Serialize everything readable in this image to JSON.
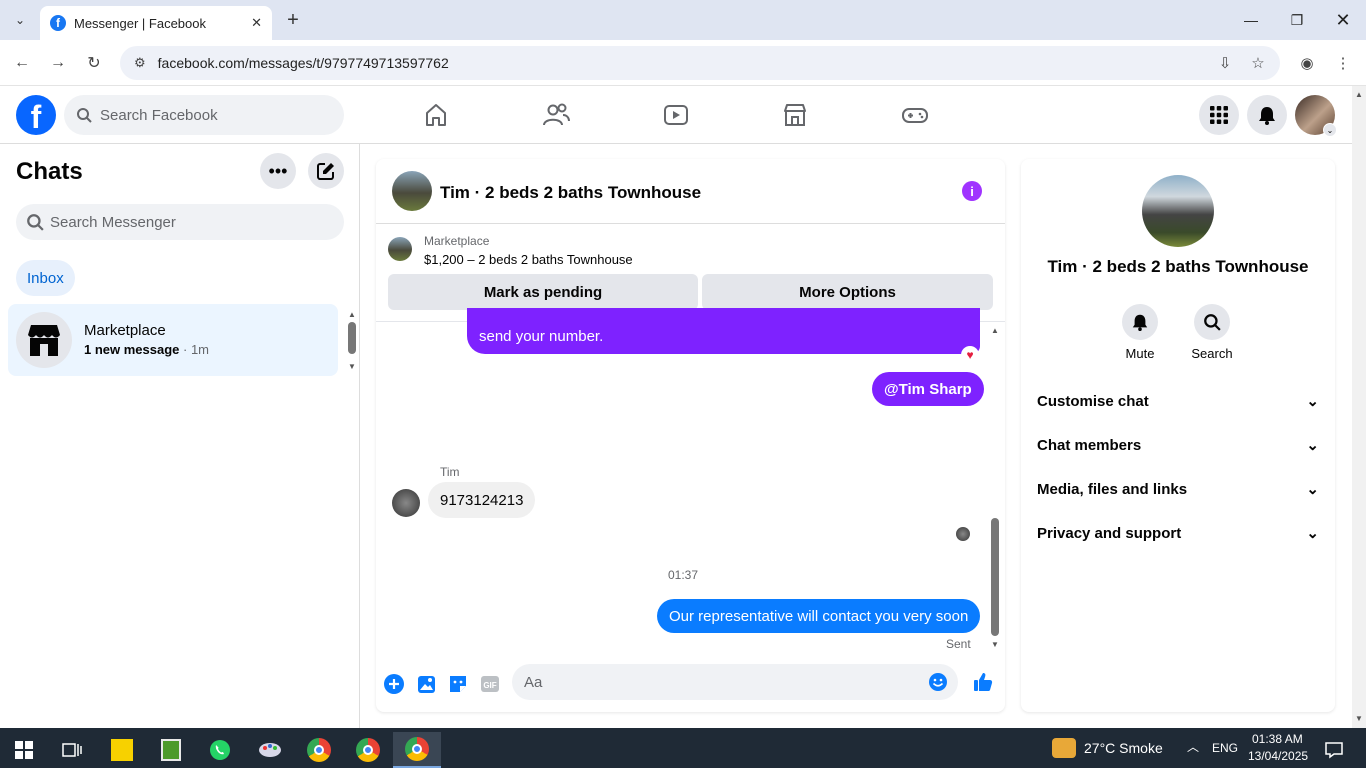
{
  "browser": {
    "tab_title": "Messenger | Facebook",
    "url": "facebook.com/messages/t/9797749713597762"
  },
  "fb": {
    "search_placeholder": "Search Facebook"
  },
  "left": {
    "title": "Chats",
    "search_placeholder": "Search Messenger",
    "filter": "Inbox",
    "chat_items": [
      {
        "name": "Marketplace",
        "preview": "1 new message",
        "time": "· 1m"
      }
    ]
  },
  "chat": {
    "header_name": "Tim · 2 beds 2 baths Townhouse",
    "marketplace_label": "Marketplace",
    "listing": "$1,200 – 2 beds 2 baths Townhouse",
    "mark_pending": "Mark as pending",
    "more_options": "More Options",
    "messages": {
      "m1": "send your number.",
      "m2": "@Tim Sharp",
      "sender": "Tim",
      "m3": "9173124213",
      "timestamp": "01:37",
      "m4": "Our representative will contact you very soon",
      "status": "Sent"
    },
    "composer_placeholder": "Aa"
  },
  "right": {
    "name": "Tim · 2 beds 2 baths Townhouse",
    "mute": "Mute",
    "search": "Search",
    "sections": [
      "Customise chat",
      "Chat members",
      "Media, files and links",
      "Privacy and support"
    ]
  },
  "taskbar": {
    "weather": "27°C  Smoke",
    "lang": "ENG",
    "time": "01:38 AM",
    "date": "13/04/2025"
  },
  "colors": {
    "fb_blue": "#0866ff",
    "purple_bubble": "#7e22ff",
    "blue_bubble": "#0a7cff"
  }
}
